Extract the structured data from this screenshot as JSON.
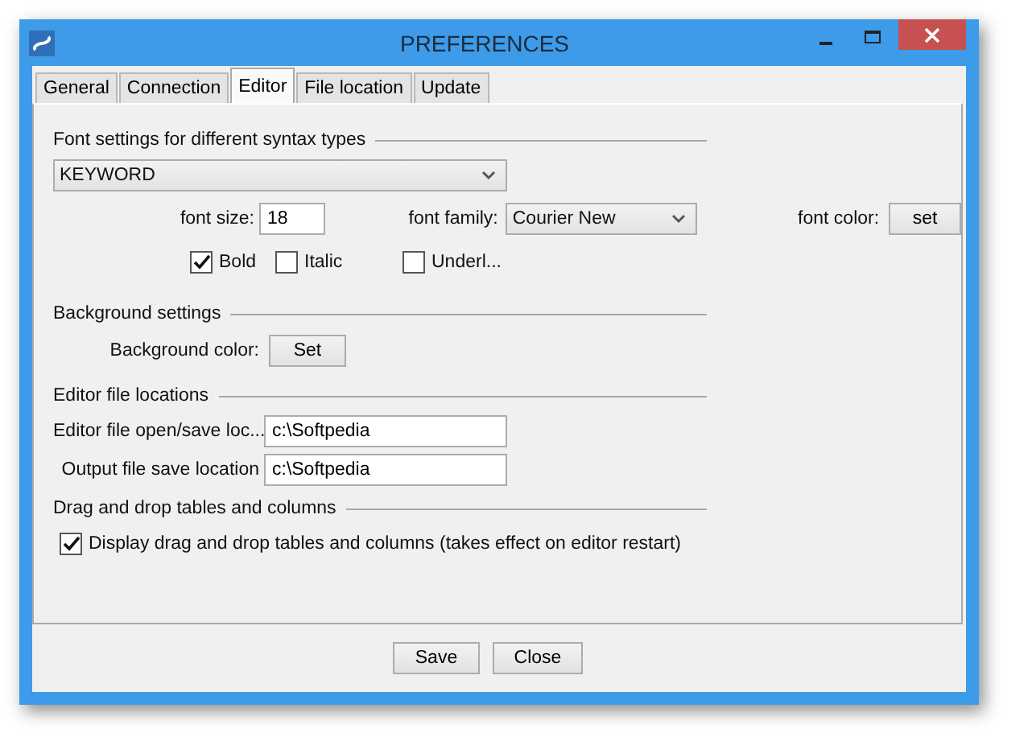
{
  "window": {
    "title": "PREFERENCES"
  },
  "tabs": [
    {
      "label": "General",
      "selected": false
    },
    {
      "label": "Connection",
      "selected": false
    },
    {
      "label": "Editor",
      "selected": true
    },
    {
      "label": "File location",
      "selected": false
    },
    {
      "label": "Update",
      "selected": false
    }
  ],
  "font_settings": {
    "heading": "Font settings for different syntax types",
    "syntax_type": "KEYWORD",
    "font_size_label": "font size:",
    "font_size": "18",
    "font_family_label": "font family:",
    "font_family": "Courier New",
    "font_color_label": "font color:",
    "font_color_button": "set",
    "styles": [
      {
        "label": "Bold",
        "checked": true
      },
      {
        "label": "Italic",
        "checked": false
      },
      {
        "label": "Underl...",
        "checked": false
      }
    ]
  },
  "background_settings": {
    "heading": "Background settings",
    "color_label": "Background color:",
    "button": "Set"
  },
  "editor_file_locations": {
    "heading": "Editor file locations",
    "fields": [
      {
        "label": "Editor file open/save loc...",
        "value": "c:\\Softpedia"
      },
      {
        "label": "Output file save location",
        "value": "c:\\Softpedia"
      }
    ]
  },
  "drag_and_drop": {
    "heading": "Drag and drop tables and columns",
    "option": {
      "label": "Display drag and drop tables and columns (takes effect on editor restart)",
      "checked": true
    }
  },
  "buttons": [
    "Save",
    "Close"
  ]
}
